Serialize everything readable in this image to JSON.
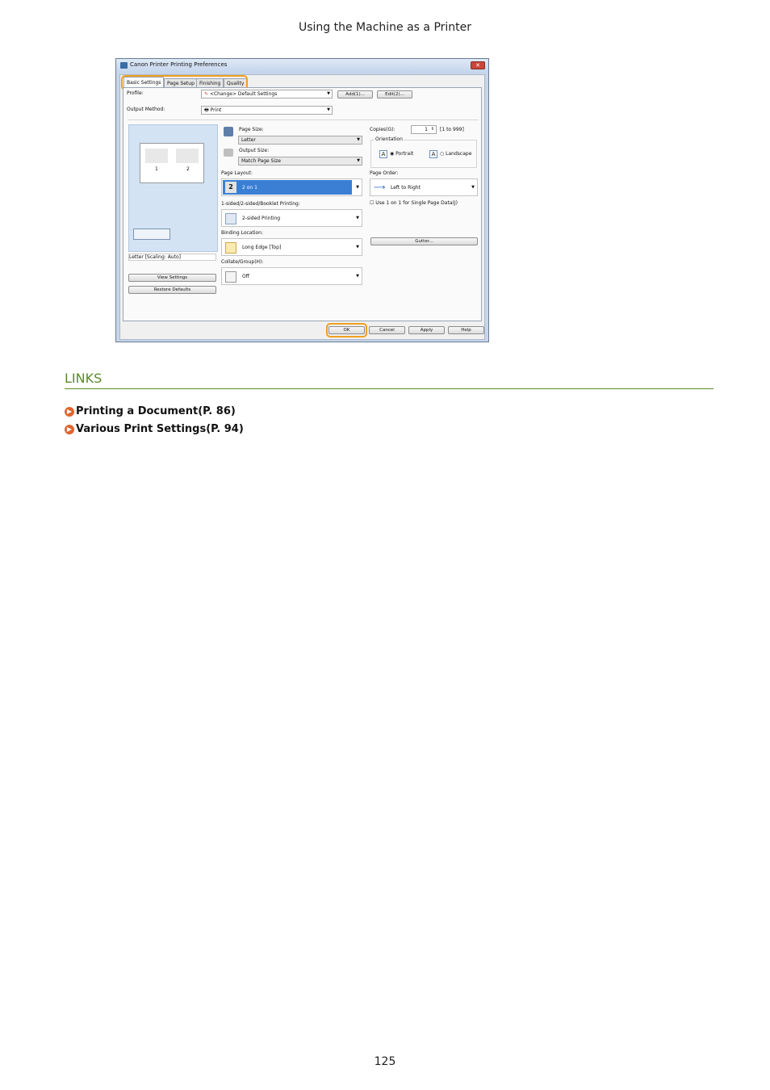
{
  "header": "Using the Machine as a Printer",
  "page_number": "125",
  "dialog": {
    "title": "Canon Printer Printing Preferences",
    "tabs": [
      "Basic Settings",
      "Page Setup",
      "Finishing",
      "Quality"
    ],
    "profile_label": "Profile:",
    "profile_value": "<Change> Default Settings",
    "add_button": "Add(1)...",
    "edit_button": "Edit(2)...",
    "output_method_label": "Output Method:",
    "output_method_value": "Print",
    "preview_caption": "Letter [Scaling: Auto]",
    "preview_page_1": "1",
    "preview_page_2": "2",
    "view_settings_button": "View Settings",
    "restore_defaults_button": "Restore Defaults",
    "page_size_label": "Page Size:",
    "page_size_value": "Letter",
    "output_size_label": "Output Size:",
    "output_size_value": "Match Page Size",
    "page_layout_label": "Page Layout:",
    "page_layout_value": "2 on 1",
    "page_layout_icon_text": "2",
    "sided_label": "1-sided/2-sided/Booklet Printing:",
    "sided_value": "2-sided Printing",
    "binding_label": "Binding Location:",
    "binding_value": "Long Edge [Top]",
    "collate_label": "Collate/Group(H):",
    "collate_value": "Off",
    "copies_label": "Copies(G):",
    "copies_value": "1",
    "copies_range": "[1 to 999]",
    "orientation_label": "Orientation",
    "portrait_label": "Portrait",
    "landscape_label": "Landscape",
    "page_order_label": "Page Order:",
    "page_order_value": "Left to Right",
    "use_1on1_label": "Use 1 on 1 for Single Page Data(J)",
    "gutter_button": "Gutter...",
    "ok_button": "OK",
    "cancel_button": "Cancel",
    "apply_button": "Apply",
    "help_button": "Help",
    "highlight_color": "#f0a020"
  },
  "links": {
    "title": "LINKS",
    "items": [
      "Printing a Document(P. 86)",
      "Various Print Settings(P. 94)"
    ],
    "accent": "#5b8a2b",
    "bullet_color": "#e2632a"
  }
}
